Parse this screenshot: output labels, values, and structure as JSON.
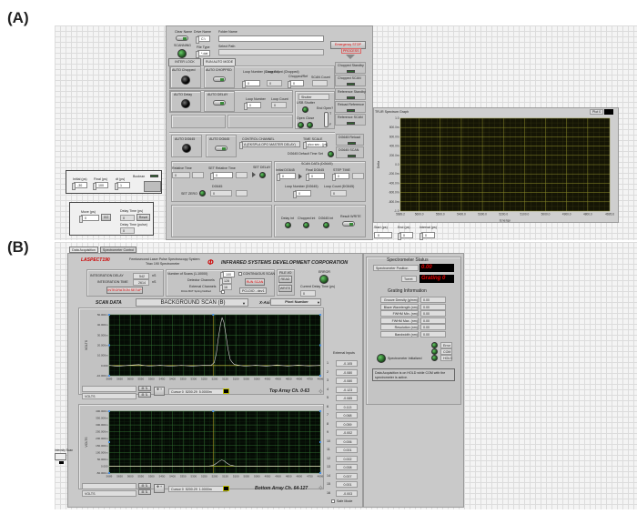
{
  "figure_labels": {
    "a": "(A)",
    "b": "(B)"
  },
  "panel_a": {
    "clear_name": "Clear Name",
    "drive_name_label": "Drive Name",
    "drive_name": "C:\\",
    "folder_name_label": "Folder Name",
    "folder_name": "",
    "scanning_label": "SCANNING",
    "file_type_label": "File Type",
    "file_type": "*.dat",
    "select_path_label": "Select Path",
    "select_path": "",
    "emergency_stop": "Emergency STOP",
    "process_label": "PROCESS",
    "tabs": [
      "INTER LOCK",
      "RUN AUTO MODE"
    ],
    "auto_chopped_led": "AUTO Chopped",
    "auto_chopped_toggle": "AUTO CHOPPED",
    "loop_number_chopped_label": "Loop Number (Chopped)",
    "loop_number_chopped": "0",
    "loop_count_chopped_label": "Loop Count (Chopped)",
    "loop_count_chopped": "0",
    "chopped_ref_label": "Chopped/Ref",
    "chopped_ref": "0",
    "scan_count_label": "SCAN Count",
    "scan_count": "",
    "auto_delay_led": "AUTO Delay",
    "auto_delay_toggle": "AUTO DELAY",
    "loop_number_label": "Loop Number",
    "loop_number": "0",
    "loop_count_label": "Loop Count",
    "loop_count": "0",
    "shutter_label": "Shutter",
    "usb_shutter": "USB Shutter",
    "end_open": "End Open?",
    "open_label": "Open",
    "close_label": "Close",
    "switch_t": "T",
    "switch_f": "F",
    "indicators": [
      "Chopped Standby",
      "Chopped SCAN",
      "Reference Standby",
      "Reload Reference",
      "Reference SCAN"
    ],
    "auto_dg645_led": "AUTO DG645",
    "auto_dg645_toggle": "AUTO DG645",
    "control_channel_label": "CONTROL CHANNEL",
    "control_channel": "A (EKSPLA OPO MASTER DELAY)",
    "time_scale_label": "TIME SCALE",
    "time_scale": "pico sec - [ps]",
    "dg645_default": "DG645 Default Time Set",
    "dg645_reload": "DG645 Reload",
    "dg645_scan": "DG645 SCAN",
    "relative_time_label": "Relative Time",
    "relative_time": "0",
    "set_relative_time_label": "SET Relative Time",
    "set_relative_time": "0",
    "set_delay": "SET DELAY",
    "set_zero": "SET ZERO",
    "dg645_label": "DG645",
    "dg645_value": "0",
    "scan_data_dg645": "SCAN DATA (DG645)",
    "initial_dg645_label": "Initial DG645",
    "initial_dg645": "0",
    "final_dg645_label": "Final DG645",
    "final_dg645": "0",
    "step_time_label": "STEP TIME",
    "step_time": "0",
    "loop_number_dg645_label": "Loop Number (DG645)",
    "loop_number_dg645": "0",
    "loop_count_dg645_label": "Loop Count (DG645)",
    "loop_count_dg645": "0",
    "delay_int": "Delay int",
    "chopped_int": "Chopped int",
    "dg645_int": "DG645 int",
    "result_write": "Result WRITE"
  },
  "scan_box": {
    "initial_label": "Initial (ps)",
    "initial": "-30",
    "final_label": "Final (ps)",
    "final": "100",
    "dt_label": "dt (ps)",
    "dt": "1",
    "boolean_label": "Boolean"
  },
  "move_box": {
    "move_label": "Move (ps)",
    "move": "0",
    "go": "GO",
    "delay_time_label": "Delay Time (ps)",
    "delay_time": "0",
    "reset": "Reset",
    "delay_pulse_label": "Delay Time (pulse)",
    "delay_pulse": "0"
  },
  "trir": {
    "title": "TR-IR Spectrum Graph",
    "legend": "Plot 0",
    "start_label": "Start (ps)",
    "start": "0",
    "end_label": "End (ps)",
    "end": "0",
    "interval_label": "Interval (ps)",
    "interval": "0"
  },
  "panel_b": {
    "tabs": [
      "Data Acquisition",
      "Spectrometer Control"
    ],
    "brand": "LASPECT190",
    "subtitle1": "Femtosecond Laser Pulse Spectroscopy System",
    "subtitle2": "Triax 190 Spectrometer",
    "company": "INFRARED SYSTEMS DEVELOPMENT CORPORATION",
    "integration_delay_label": "INTEGRATION DELAY",
    "integration_delay": "542",
    "integration_delay_unit": "nS",
    "integration_time_label": "INTEGRATION TIME",
    "integration_time": "2614",
    "integration_time_unit": "nS",
    "integration_setup": "INTEGRATION SETUP",
    "num_scans_label": "Number of Scans (1-10000)",
    "num_scans": "100",
    "continuous_scan": "CONTINUOUS SCAN",
    "detector_channels_label": "Detector Channels",
    "detector_channels": "128",
    "external_channels_label": "External Channels",
    "external_channels": "16",
    "dual_label": "DUAL BUT Spring Notified",
    "run_scan": "RUN SCAN",
    "device": "PCI-DIO - dev1",
    "file_io": "FILE I/O",
    "read": "READ",
    "write": "WRITE",
    "error": "ERROR",
    "current_delay_label": "Current  Delay Time  (ps)",
    "current_delay": "0",
    "scan_data": "SCAN DATA",
    "scan_type": "BACKGROUND SCAN (B)",
    "x_axis_label": "X-Axis",
    "x_axis": "Pixel Number",
    "top_caption": "Top Array Ch. 0-63",
    "bottom_caption": "Bottom Array Ch. 64-127",
    "volts": "VOLTS",
    "top_cursor": {
      "name": "Cursor 0",
      "x": "5200.29",
      "y": "5.0000m"
    },
    "bottom_cursor": {
      "name": "Cursor 0",
      "x": "5200.29",
      "y": "1.0000m"
    },
    "external_inputs_label": "External Inputs",
    "external_inputs": [
      "-0.105",
      "-0.080",
      "-0.080",
      "-0.123",
      "-0.085",
      "0.113",
      "0.068",
      "0.059",
      "-0.002",
      "0.006",
      "0.001",
      "0.002",
      "0.008",
      "0.007",
      "0.001",
      "-0.003"
    ],
    "safe_mode": "Safe Mode",
    "intensity_scan": "Intensity Scan"
  },
  "spectrometer": {
    "title": "Spectrometer Status",
    "position_label": "Spectrometer Position",
    "position": "0.00",
    "turret_label": "Turret",
    "turret": "Grating 0",
    "grating_title": "Grating Information",
    "rows": [
      {
        "label": "Groove Density (g/mm)",
        "value": "0.00"
      },
      {
        "label": "Blaze Wavelength (nm)",
        "value": "0.00"
      },
      {
        "label": "FWHM Min. (nm)",
        "value": "0.00"
      },
      {
        "label": "FWHM Max. (nm)",
        "value": "0.00"
      },
      {
        "label": "Resolution (nm)",
        "value": "0.00"
      },
      {
        "label": "Bandwidth (nm)",
        "value": "0.00"
      }
    ],
    "error": "Error",
    "com": "COM",
    "hold": "HOLD",
    "initialized": "Spectrometer Initialized",
    "message": "Data Acquisition is on HOLD while COM with the spectrometer is active."
  },
  "chart_data": [
    {
      "id": "trir",
      "type": "line",
      "title": "TR-IR Spectrum Graph",
      "xlabel": "Energy",
      "ylabel": "Delta",
      "xlim": [
        5689.2,
        4695.6
      ],
      "ylim": [
        -1,
        1
      ],
      "xticks": [
        5689.2,
        5600,
        5500,
        5400,
        5300,
        5200,
        5100,
        5000,
        4900,
        4800,
        4695.6
      ],
      "xticklabels": [
        "5689.2",
        "5600.0",
        "5500.0",
        "5400.0",
        "5300.0",
        "5200.0",
        "5100.0",
        "5000.0",
        "4900.0",
        "4800.0",
        "4695.6"
      ],
      "yticks": [
        1,
        0.8,
        0.6,
        0.4,
        0.2,
        0,
        -0.2,
        -0.4,
        -0.6,
        -0.8,
        -1
      ],
      "yticklabels": [
        "1.0",
        "800.0m",
        "600.0m",
        "400.0m",
        "200.0m",
        "0.0",
        "-200.0m",
        "-400.0m",
        "-600.0m",
        "-800.0m",
        "-1.0"
      ],
      "series": [
        {
          "name": "Plot 0",
          "x": [],
          "y": []
        }
      ]
    },
    {
      "id": "top",
      "type": "line",
      "title": "Top Array Ch. 0-63",
      "xlabel": "",
      "ylabel": "VOLTS",
      "xlim": [
        5689,
        4696
      ],
      "ylim": [
        -0.01,
        0.05
      ],
      "xticklabels": [
        "5689",
        "5650",
        "5600",
        "5550",
        "5500",
        "5450",
        "5400",
        "5350",
        "5300",
        "5250",
        "5200",
        "5150",
        "5100",
        "5050",
        "5000",
        "4950",
        "4900",
        "4850",
        "4800",
        "4750",
        "4696"
      ],
      "yticks": [
        0.05,
        0.04,
        0.03,
        0.02,
        0.01,
        0,
        -0.01
      ],
      "yticklabels": [
        "50.000m",
        "40.000m",
        "30.000m",
        "20.000m",
        "10.000m",
        "0.000",
        "-10.000m"
      ],
      "cursor": {
        "x": 5200,
        "y": 0
      },
      "series": [
        {
          "name": "Top",
          "x": [
            5689,
            5650,
            5600,
            5550,
            5500,
            5450,
            5400,
            5350,
            5300,
            5250,
            5210,
            5195,
            5185,
            5175,
            5165,
            5158,
            5150,
            5140,
            5130,
            5120,
            5110,
            5100,
            5050,
            5000,
            4950,
            4900,
            4850,
            4800,
            4750,
            4696
          ],
          "y": [
            0.0003,
            -0.0008,
            0.0002,
            0.0009,
            -0.0006,
            0.0004,
            -0.0007,
            0.0003,
            -0.0005,
            0.0002,
            0.0002,
            0.003,
            0.012,
            0.028,
            0.041,
            0.047,
            0.043,
            0.03,
            0.016,
            0.006,
            0.003,
            0.001,
            -0.0006,
            0.0004,
            -0.0005,
            0.0006,
            -0.0004,
            0.0005,
            -0.0003,
            0.0002
          ]
        }
      ]
    },
    {
      "id": "bottom",
      "type": "line",
      "title": "Bottom Array Ch. 64-127",
      "xlabel": "",
      "ylabel": "VOLTS",
      "xlim": [
        5689,
        4696
      ],
      "ylim": [
        -0.05,
        0.4
      ],
      "xticklabels": [
        "5689",
        "5650",
        "5600",
        "5550",
        "5500",
        "5450",
        "5400",
        "5350",
        "5300",
        "5250",
        "5200",
        "5150",
        "5100",
        "5050",
        "5000",
        "4950",
        "4900",
        "4850",
        "4800",
        "4750",
        "4696"
      ],
      "yticks": [
        0.4,
        0.35,
        0.3,
        0.25,
        0.2,
        0.15,
        0.1,
        0.05,
        0,
        -0.05
      ],
      "yticklabels": [
        "400.000m",
        "350.000m",
        "300.000m",
        "250.000m",
        "200.000m",
        "150.000m",
        "100.000m",
        "50.000m",
        "0.000",
        "-50.000m"
      ],
      "cursor": {
        "x": 5200,
        "y": 0
      },
      "series": [
        {
          "name": "Bottom",
          "x": [
            5689,
            5500,
            5300,
            5220,
            5200,
            5185,
            5170,
            5160,
            5150,
            5135,
            5120,
            5100,
            5000,
            4800,
            4696
          ],
          "y": [
            0,
            0.001,
            0,
            0.001,
            0.006,
            0.02,
            0.038,
            0.045,
            0.04,
            0.022,
            0.008,
            0.002,
            0,
            0,
            0
          ]
        }
      ]
    }
  ]
}
